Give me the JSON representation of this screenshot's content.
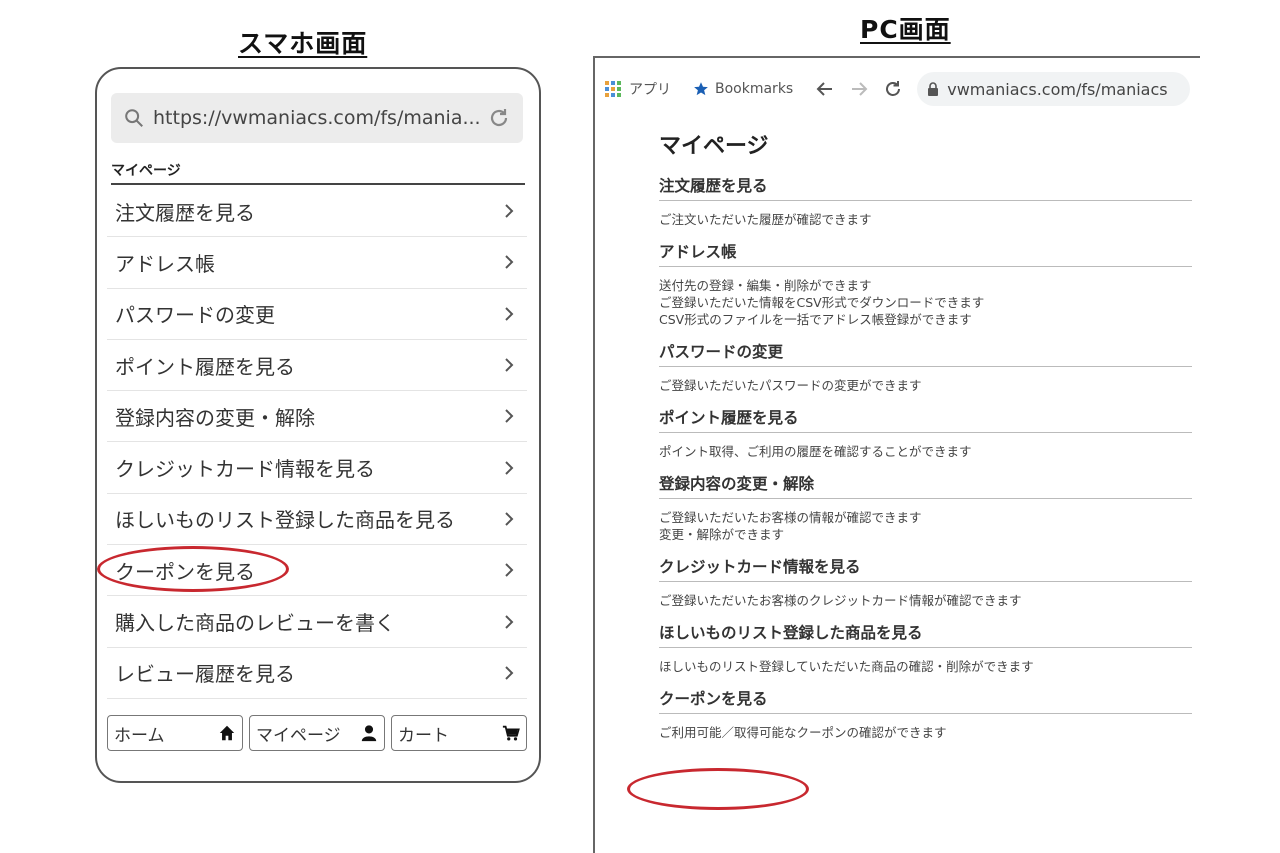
{
  "headings": {
    "smartphone": "スマホ画面",
    "pc": "PC画面"
  },
  "smartphone": {
    "url": "https://vwmaniacs.com/fs/mania...",
    "title": "マイページ",
    "menu": [
      "注文履歴を見る",
      "アドレス帳",
      "パスワードの変更",
      "ポイント履歴を見る",
      "登録内容の変更・解除",
      "クレジットカード情報を見る",
      "ほしいものリスト登録した商品を見る",
      "クーポンを見る",
      "購入した商品のレビューを書く",
      "レビュー履歴を見る"
    ],
    "footer": {
      "home": "ホーム",
      "mypage": "マイページ",
      "cart": "カート"
    }
  },
  "pc": {
    "apps_label": "アプリ",
    "bookmarks_label": "Bookmarks",
    "url": "vwmaniacs.com/fs/maniacs",
    "title": "マイページ",
    "sections": [
      {
        "head": "注文履歴を見る",
        "desc": [
          "ご注文いただいた履歴が確認できます"
        ]
      },
      {
        "head": "アドレス帳",
        "desc": [
          "送付先の登録・編集・削除ができます",
          "ご登録いただいた情報をCSV形式でダウンロードできます",
          "CSV形式のファイルを一括でアドレス帳登録ができます"
        ]
      },
      {
        "head": "パスワードの変更",
        "desc": [
          "ご登録いただいたパスワードの変更ができます"
        ]
      },
      {
        "head": "ポイント履歴を見る",
        "desc": [
          "ポイント取得、ご利用の履歴を確認することができます"
        ]
      },
      {
        "head": "登録内容の変更・解除",
        "desc": [
          "ご登録いただいたお客様の情報が確認できます",
          "変更・解除ができます"
        ]
      },
      {
        "head": "クレジットカード情報を見る",
        "desc": [
          "ご登録いただいたお客様のクレジットカード情報が確認できます"
        ]
      },
      {
        "head": "ほしいものリスト登録した商品を見る",
        "desc": [
          "ほしいものリスト登録していただいた商品の確認・削除ができます"
        ]
      },
      {
        "head": "クーポンを見る",
        "desc": [
          "ご利用可能／取得可能なクーポンの確認ができます"
        ]
      }
    ]
  },
  "colors": {
    "highlight": "#c8282f",
    "bookmark_star": "#1a5fb4"
  },
  "icons": [
    "search-icon",
    "reload-icon",
    "chevron-right-icon",
    "home-icon",
    "user-icon",
    "cart-icon",
    "apps-icon",
    "star-icon",
    "back-icon",
    "forward-icon",
    "refresh-icon",
    "lock-icon"
  ]
}
